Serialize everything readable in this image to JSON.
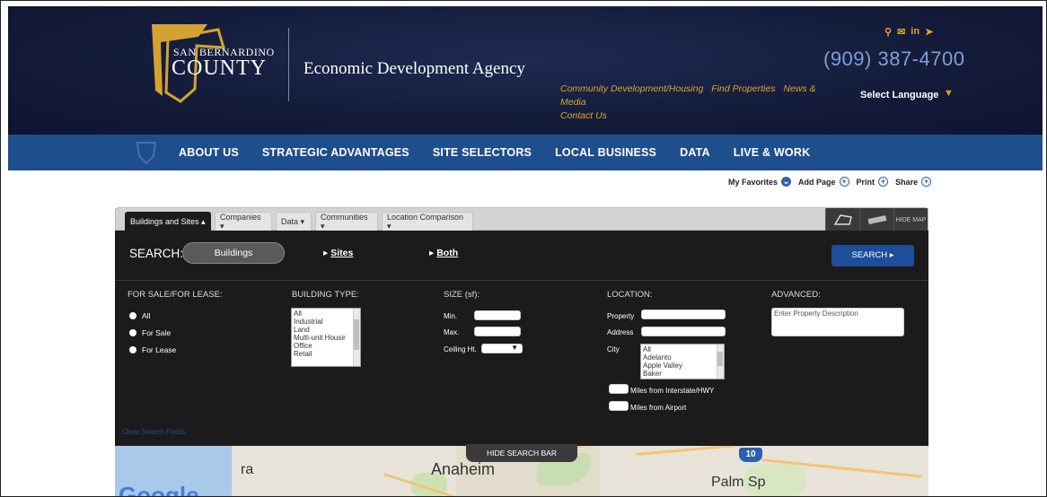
{
  "header": {
    "logo_line1": "SAN BERNARDINO",
    "logo_line2": "COUNTY",
    "agency_name": "Economic Development Agency",
    "phone": "(909) 387-4700",
    "select_language": "Select Language",
    "util_links": [
      "Community Development/Housing",
      "Find Properties",
      "News & Media",
      "Contact Us"
    ],
    "social_icons": [
      "search-icon",
      "email-icon",
      "linkedin-icon",
      "twitter-icon"
    ]
  },
  "nav": {
    "items": [
      "ABOUT US",
      "STRATEGIC ADVANTAGES",
      "SITE SELECTORS",
      "LOCAL BUSINESS",
      "DATA",
      "LIVE & WORK"
    ]
  },
  "tools": {
    "favorites": "My Favorites",
    "add_page": "Add Page",
    "print": "Print",
    "share": "Share"
  },
  "tabs": [
    {
      "label": "Buildings and Sites ▴",
      "active": true
    },
    {
      "label": "Companies ▾",
      "active": false
    },
    {
      "label": "Data ▾",
      "active": false
    },
    {
      "label": "Communities ▾",
      "active": false
    },
    {
      "label": "Location Comparison ▾",
      "active": false
    }
  ],
  "maptools": {
    "hide_map": "HIDE MAP"
  },
  "search": {
    "label": "SEARCH:",
    "buildings": "Buildings",
    "sites": "Sites",
    "both": "Both",
    "button": "SEARCH ▸"
  },
  "filters": {
    "sale_lease_header": "FOR SALE/FOR LEASE:",
    "sale_lease_options": [
      "All",
      "For Sale",
      "For Lease"
    ],
    "building_type_header": "BUILDING TYPE:",
    "building_types": [
      "All",
      "Industrial",
      "Land",
      "Multi-unit Housir",
      "Office",
      "Retail"
    ],
    "size_header": "SIZE (sf):",
    "min_label": "Min.",
    "max_label": "Max.",
    "ceiling_label": "Ceiling Ht.",
    "location_header": "LOCATION:",
    "property_label": "Property",
    "address_label": "Address",
    "city_label": "City",
    "cities": [
      "All",
      "Adelanto",
      "Apple Valley",
      "Baker"
    ],
    "miles_interstate": "Miles from Interstate/HWY",
    "miles_airport": "Miles from Airport",
    "advanced_header": "ADVANCED:",
    "advanced_placeholder": "Enter Property Description",
    "clear": "Clear Search Fields"
  },
  "map": {
    "hide_search_bar": "HIDE SEARCH BAR",
    "labels": [
      "ra",
      "Anaheim",
      "Palm Sp"
    ],
    "highway": "10",
    "google": "Google"
  }
}
